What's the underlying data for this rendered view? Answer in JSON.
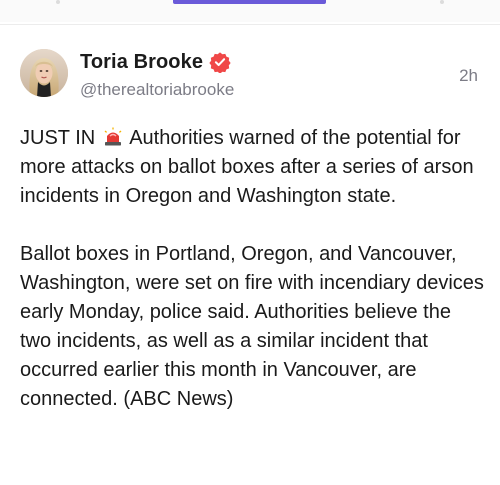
{
  "post": {
    "author": {
      "name": "Toria Brooke",
      "handle": "@therealtoriabrooke",
      "verified": true
    },
    "timestamp": "2h",
    "paragraphs": [
      {
        "before_icon": "JUST IN",
        "icon": "police-siren-icon",
        "after_icon": " Authorities warned of the potential for more attacks on ballot boxes after a series of arson incidents in Oregon and Washington state."
      },
      {
        "text": "Ballot boxes in Portland, Oregon, and Vancouver, Washington, were set on fire with incendiary devices early Monday, police said. Authorities believe the two incidents, as well as a similar incident that occurred earlier this month in Vancouver, are connected. (ABC News)"
      }
    ]
  },
  "colors": {
    "accent": "#6a5ad9",
    "verified_badge": "#f04848",
    "secondary_text": "#7c7c86",
    "primary_text": "#1a1a1a"
  }
}
